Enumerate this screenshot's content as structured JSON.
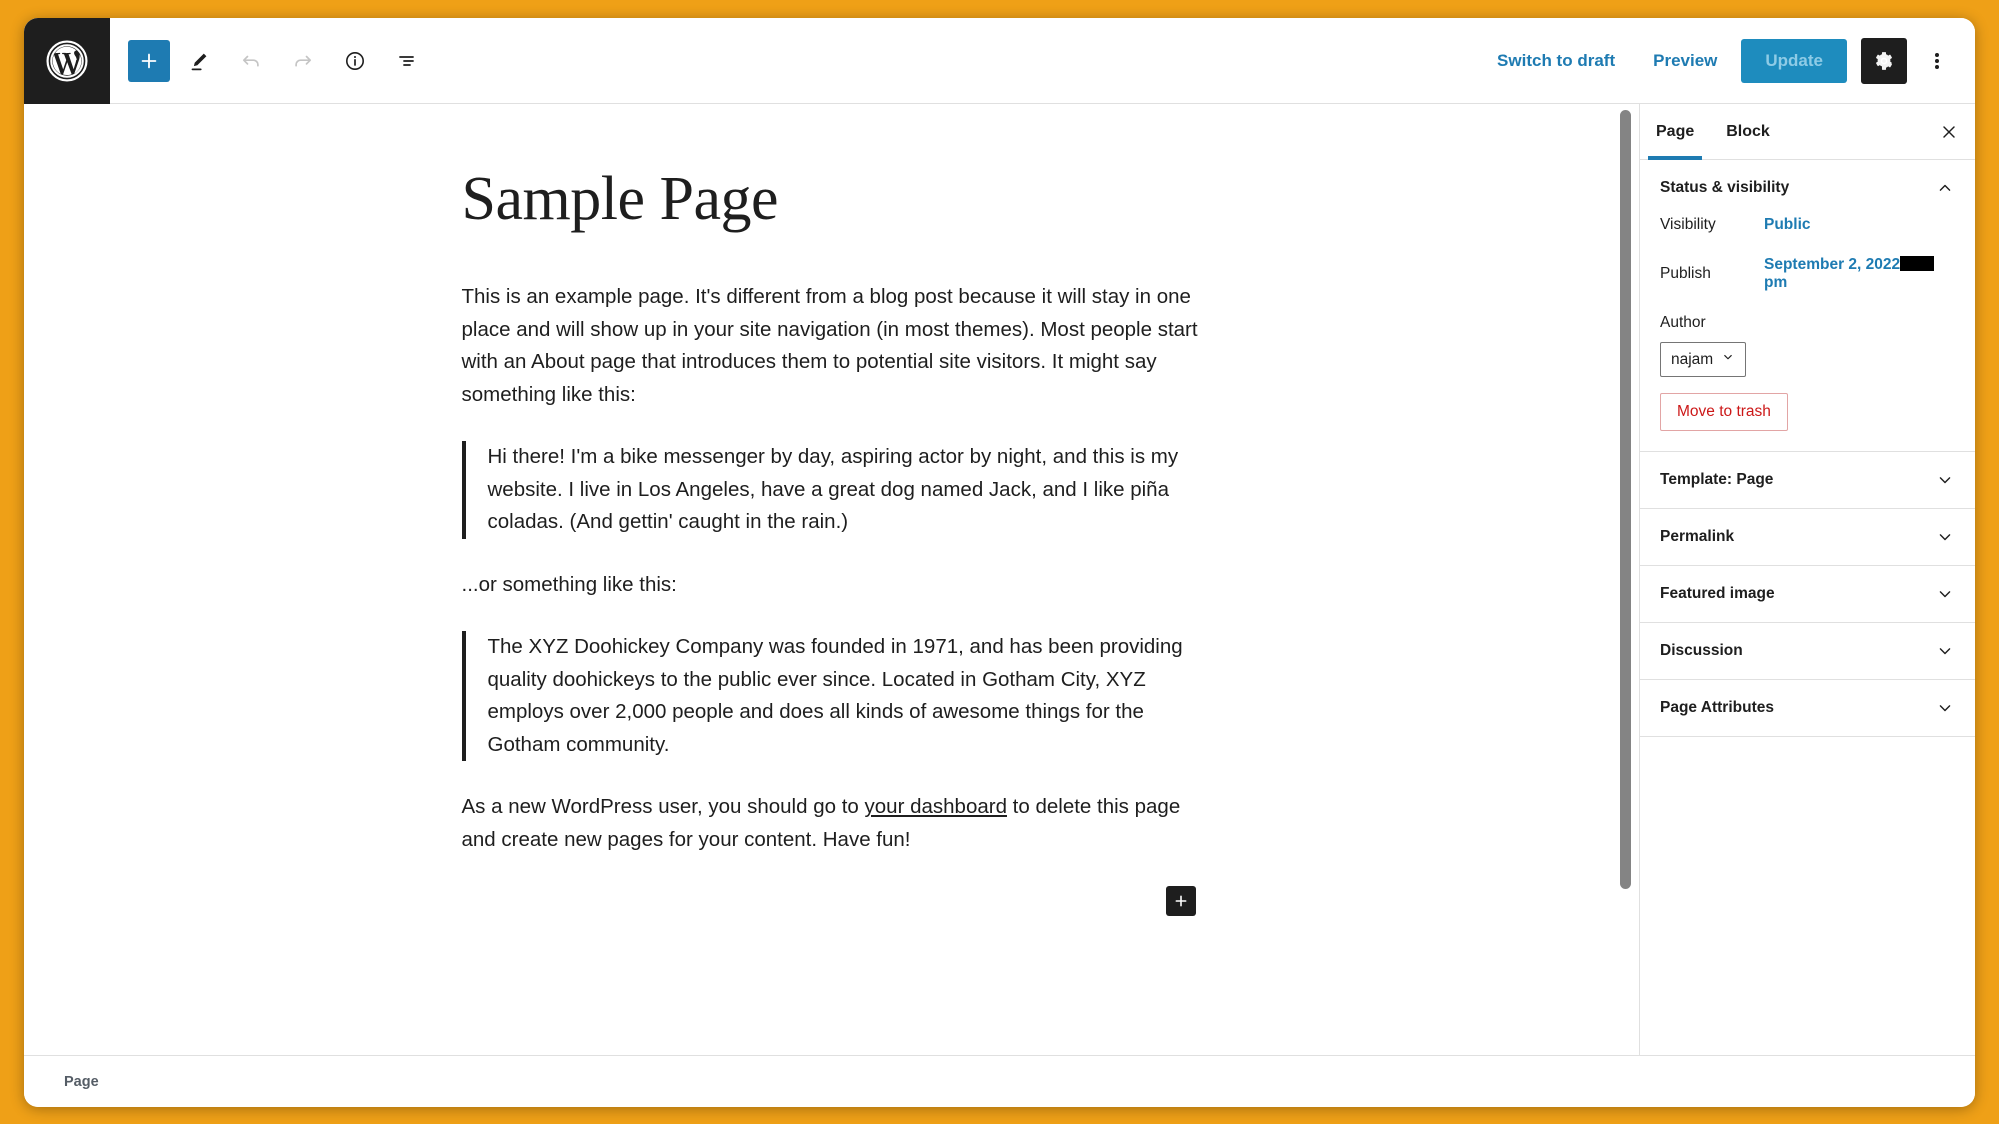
{
  "window": {
    "background_color": "#efa017",
    "accent_color": "#1e7bb2"
  },
  "header": {
    "logo_icon": "wordpress-logo-icon",
    "tools": [
      {
        "name": "add-block-button",
        "icon": "plus-icon",
        "label": "Toggle block inserter",
        "state": "active"
      },
      {
        "name": "tools-button",
        "icon": "pencil-icon",
        "label": "Tools",
        "state": "enabled"
      },
      {
        "name": "undo-button",
        "icon": "undo-arrow-icon",
        "label": "Undo",
        "state": "disabled"
      },
      {
        "name": "redo-button",
        "icon": "redo-arrow-icon",
        "label": "Redo",
        "state": "disabled"
      },
      {
        "name": "details-button",
        "icon": "info-circle-icon",
        "label": "Details",
        "state": "enabled"
      },
      {
        "name": "list-view-button",
        "icon": "list-view-icon",
        "label": "List view",
        "state": "enabled"
      }
    ],
    "switch_to_draft_label": "Switch to draft",
    "preview_label": "Preview",
    "update_label": "Update",
    "update_disabled": true,
    "settings_icon": "gear-icon",
    "more_menu_icon": "kebab-menu-icon"
  },
  "canvas": {
    "title": "Sample Page",
    "blocks": [
      {
        "type": "paragraph",
        "text": "This is an example page. It's different from a blog post because it will stay in one place and will show up in your site navigation (in most themes). Most people start with an About page that introduces them to potential site visitors. It might say something like this:"
      },
      {
        "type": "quote",
        "text": "Hi there! I'm a bike messenger by day, aspiring actor by night, and this is my website. I live in Los Angeles, have a great dog named Jack, and I like piña coladas. (And gettin' caught in the rain.)"
      },
      {
        "type": "paragraph",
        "text": "...or something like this:"
      },
      {
        "type": "quote",
        "text": "The XYZ Doohickey Company was founded in 1971, and has been providing quality doohickeys to the public ever since. Located in Gotham City, XYZ employs over 2,000 people and does all kinds of awesome things for the Gotham community."
      }
    ],
    "closing_paragraph": {
      "before_link": "As a new WordPress user, you should go to ",
      "link_text": "your dashboard",
      "after_link": " to delete this page and create new pages for your content. Have fun!"
    },
    "appender_icon": "plus-icon"
  },
  "sidebar": {
    "tabs": [
      {
        "label": "Page",
        "active": true
      },
      {
        "label": "Block",
        "active": false
      }
    ],
    "close_icon": "close-icon",
    "status_panel": {
      "title": "Status & visibility",
      "expanded": true,
      "chevron_icon": "chevron-up-icon",
      "visibility_label": "Visibility",
      "visibility_value": "Public",
      "publish_label": "Publish",
      "publish_value_prefix": "September 2, 2022",
      "publish_value_suffix": "pm",
      "publish_redacted": true,
      "author_label": "Author",
      "author_value": "najam",
      "author_chevron_icon": "chevron-down-icon",
      "move_to_trash_label": "Move to trash"
    },
    "panels": [
      {
        "title": "Template: Page",
        "chevron_icon": "chevron-down-icon"
      },
      {
        "title": "Permalink",
        "chevron_icon": "chevron-down-icon"
      },
      {
        "title": "Featured image",
        "chevron_icon": "chevron-down-icon"
      },
      {
        "title": "Discussion",
        "chevron_icon": "chevron-down-icon"
      },
      {
        "title": "Page Attributes",
        "chevron_icon": "chevron-down-icon"
      }
    ]
  },
  "footer": {
    "breadcrumb": "Page"
  }
}
